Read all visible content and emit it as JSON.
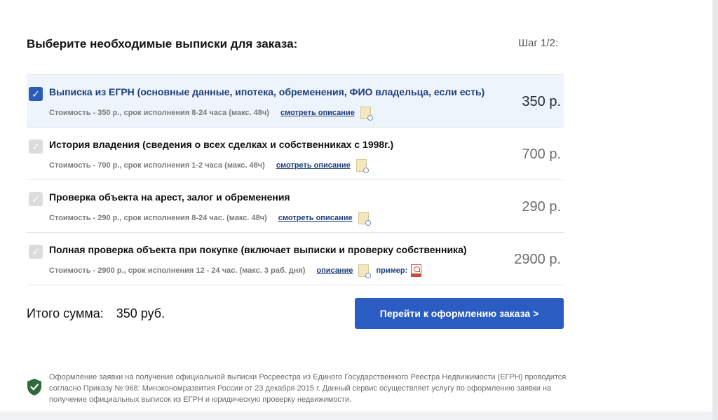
{
  "header": {
    "title": "Выберите необходимые выписки для заказа:",
    "step": "Шаг 1/2:"
  },
  "items": [
    {
      "title": "Выписка из ЕГРН (основные данные, ипотека, обременения, ФИО владельца, если есть)",
      "meta": "Стоимость - 350 р., срок исполнения 8-24 часа (макс. 48ч)",
      "link": "смотреть описание",
      "price": "350 р.",
      "checked": true
    },
    {
      "title": "История владения (сведения о всех сделках и собственниках с 1998г.)",
      "meta": "Стоимость - 700 р., срок исполнения 1-2 часа (макс. 48ч)",
      "link": "смотреть описание",
      "price": "700 р.",
      "checked": false
    },
    {
      "title": "Проверка объекта на арест, залог и обременения",
      "meta": "Стоимость - 290 р., срок исполнения 8-24 час. (макс. 48ч)",
      "link": "смотреть описание",
      "price": "290 р.",
      "checked": false
    },
    {
      "title": "Полная проверка объекта при покупке (включает выписки и проверку собственника)",
      "meta": "Стоимость - 2900 р., срок исполнения 12 - 24 час. (макс. 3 раб. дня)",
      "link": "описание",
      "example_label": "пример:",
      "price": "2900 р.",
      "checked": false
    }
  ],
  "checkbox_mark": "✓",
  "total": {
    "label": "Итого сумма:",
    "amount": "350 руб."
  },
  "cta_label": "Перейти к оформлению заказа >",
  "notice": "Оформление заявки на получение официальной выписки Росреестра из Единого Государственного Реестра Недвижимости (ЕГРН) проводится согласно Приказу № 968: Минэкономразвития России от 23 декабря 2015 г. Данный сервис осуществляет услугу по оформлению заявки на получение официальных выписок из ЕГРН и юридическую проверку недвижимости.",
  "colors": {
    "accent": "#2b5cc1",
    "selected_row_bg": "#eef4fb",
    "shield": "#2f6b3a"
  },
  "icons": {
    "checkbox": "check-icon",
    "description": "document-search-icon",
    "example": "pdf-icon",
    "notice": "shield-check-icon"
  }
}
